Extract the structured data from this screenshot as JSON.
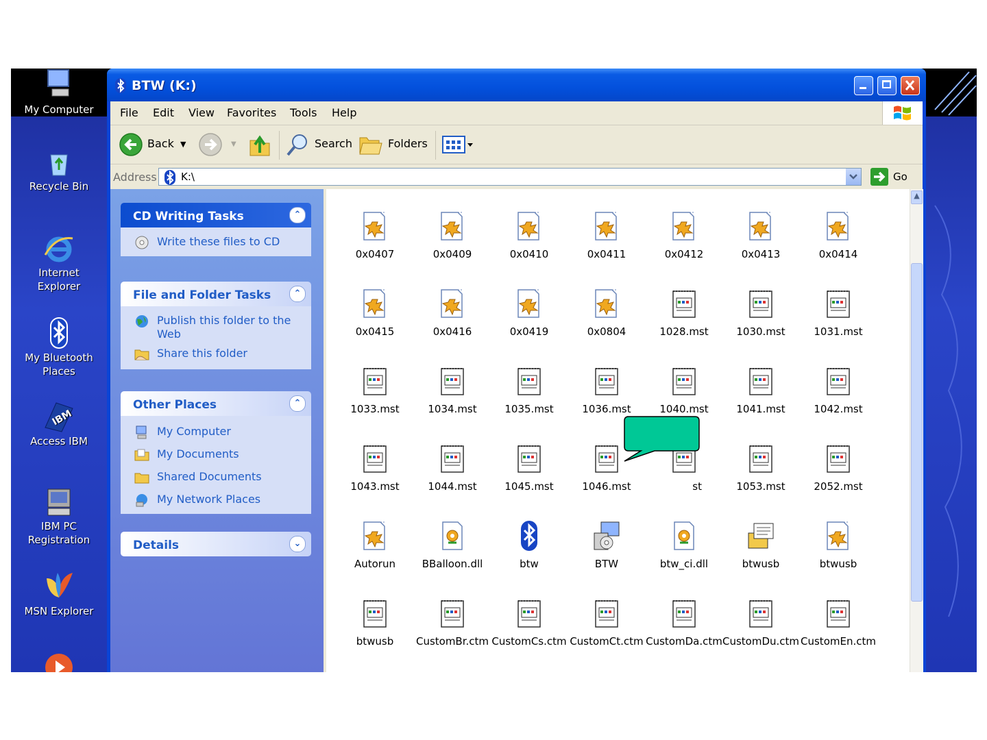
{
  "desktop": {
    "icons": [
      {
        "label": "My Computer",
        "icon": "my-computer-icon"
      },
      {
        "label": "Recycle Bin",
        "icon": "recycle-bin-icon"
      },
      {
        "label": "Internet\nExplorer",
        "icon": "internet-explorer-icon"
      },
      {
        "label": "My Bluetooth\nPlaces",
        "icon": "bluetooth-icon"
      },
      {
        "label": "Access IBM",
        "icon": "ibm-icon"
      },
      {
        "label": "IBM PC\nRegistration",
        "icon": "ibm-registration-icon"
      },
      {
        "label": "MSN Explorer",
        "icon": "msn-butterfly-icon"
      }
    ]
  },
  "window": {
    "title": "BTW (K:)",
    "menu": [
      "File",
      "Edit",
      "View",
      "Favorites",
      "Tools",
      "Help"
    ],
    "toolbar": {
      "back": "Back",
      "search": "Search",
      "folders": "Folders"
    },
    "address": {
      "label": "Address",
      "value": "K:\\",
      "go": "Go"
    }
  },
  "taskpane": {
    "cd_tasks": {
      "title": "CD Writing Tasks",
      "items": [
        "Write these files to CD"
      ]
    },
    "file_tasks": {
      "title": "File and Folder Tasks",
      "items": [
        "Publish this folder to the Web",
        "Share this folder"
      ]
    },
    "other_places": {
      "title": "Other Places",
      "items": [
        "My Computer",
        "My Documents",
        "Shared Documents",
        "My Network Places"
      ]
    },
    "details": {
      "title": "Details"
    }
  },
  "files": [
    {
      "name": "0x0407",
      "type": "ini"
    },
    {
      "name": "0x0409",
      "type": "ini"
    },
    {
      "name": "0x0410",
      "type": "ini"
    },
    {
      "name": "0x0411",
      "type": "ini"
    },
    {
      "name": "0x0412",
      "type": "ini"
    },
    {
      "name": "0x0413",
      "type": "ini"
    },
    {
      "name": "0x0414",
      "type": "ini"
    },
    {
      "name": "0x0415",
      "type": "ini"
    },
    {
      "name": "0x0416",
      "type": "ini"
    },
    {
      "name": "0x0419",
      "type": "ini"
    },
    {
      "name": "0x0804",
      "type": "ini"
    },
    {
      "name": "1028.mst",
      "type": "doc"
    },
    {
      "name": "1030.mst",
      "type": "doc"
    },
    {
      "name": "1031.mst",
      "type": "doc"
    },
    {
      "name": "1033.mst",
      "type": "doc"
    },
    {
      "name": "1034.mst",
      "type": "doc"
    },
    {
      "name": "1035.mst",
      "type": "doc"
    },
    {
      "name": "1036.mst",
      "type": "doc"
    },
    {
      "name": "1040.mst",
      "type": "doc"
    },
    {
      "name": "1041.mst",
      "type": "doc"
    },
    {
      "name": "1042.mst",
      "type": "doc"
    },
    {
      "name": "1043.mst",
      "type": "doc"
    },
    {
      "name": "1044.mst",
      "type": "doc"
    },
    {
      "name": "1045.mst",
      "type": "doc"
    },
    {
      "name": "1046.mst",
      "type": "doc"
    },
    {
      "name": "st",
      "type": "doc"
    },
    {
      "name": "1053.mst",
      "type": "doc"
    },
    {
      "name": "2052.mst",
      "type": "doc"
    },
    {
      "name": "Autorun",
      "type": "ini"
    },
    {
      "name": "BBalloon.dll",
      "type": "dll"
    },
    {
      "name": "btw",
      "type": "bluetooth"
    },
    {
      "name": "BTW",
      "type": "setup"
    },
    {
      "name": "btw_ci.dll",
      "type": "dll"
    },
    {
      "name": "btwusb",
      "type": "cat"
    },
    {
      "name": "btwusb",
      "type": "ini"
    },
    {
      "name": "btwusb",
      "type": "doc"
    },
    {
      "name": "CustomBr.ctm",
      "type": "doc"
    },
    {
      "name": "CustomCs.ctm",
      "type": "doc"
    },
    {
      "name": "CustomCt.ctm",
      "type": "doc"
    },
    {
      "name": "CustomDa.ctm",
      "type": "doc"
    },
    {
      "name": "CustomDu.ctm",
      "type": "doc"
    },
    {
      "name": "CustomEn.ctm",
      "type": "doc"
    }
  ],
  "colors": {
    "callout": "#00c896",
    "titlebar": "#0a5be4",
    "taskpane": "#6f8ee0",
    "link": "#215dc6"
  }
}
